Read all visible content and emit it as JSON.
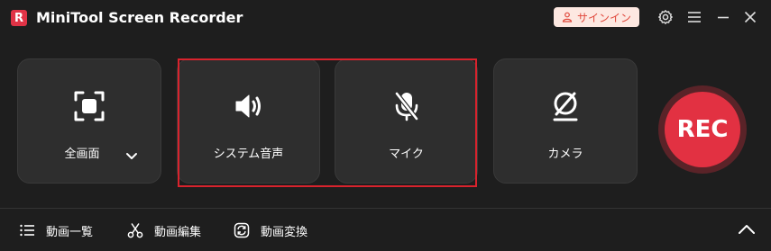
{
  "app": {
    "title": "MiniTool Screen Recorder",
    "logo_letter": "R"
  },
  "header": {
    "signin_label": "サインイン"
  },
  "cards": {
    "fullscreen_label": "全画面",
    "system_audio_label": "システム音声",
    "mic_label": "マイク",
    "camera_label": "カメラ"
  },
  "rec": {
    "label": "REC"
  },
  "bottom": {
    "video_list_label": "動画一覧",
    "video_edit_label": "動画編集",
    "video_convert_label": "動画変換"
  },
  "colors": {
    "accent_red": "#e23142",
    "highlight_border": "#d9232d",
    "signin_bg": "#fde8e1",
    "background": "#1e1e1e",
    "card_bg": "#2e2e2e"
  },
  "icons": {
    "titlebar": [
      "gear-icon",
      "menu-icon",
      "minimize-icon",
      "close-icon"
    ],
    "cards": [
      "fullscreen-icon",
      "chevron-down-icon",
      "speaker-icon",
      "mic-muted-icon",
      "camera-off-icon"
    ],
    "bottom": [
      "list-icon",
      "scissors-icon",
      "convert-icon",
      "chevron-up-icon"
    ]
  }
}
